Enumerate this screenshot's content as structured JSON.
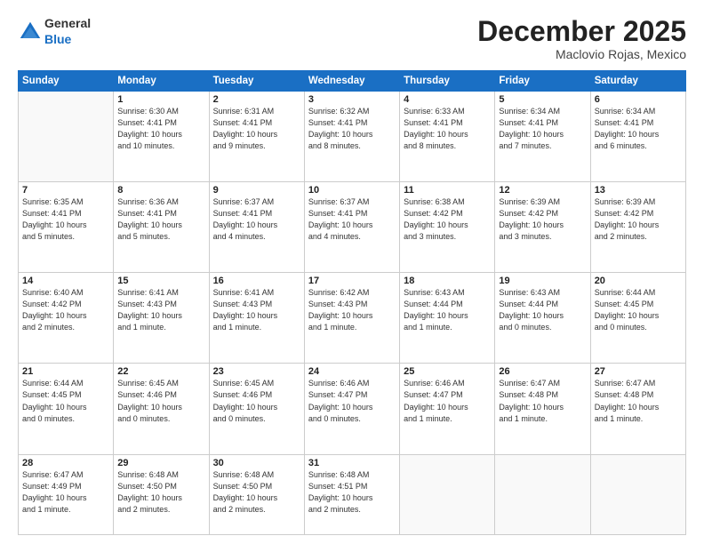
{
  "logo": {
    "general": "General",
    "blue": "Blue"
  },
  "title": "December 2025",
  "location": "Maclovio Rojas, Mexico",
  "days_header": [
    "Sunday",
    "Monday",
    "Tuesday",
    "Wednesday",
    "Thursday",
    "Friday",
    "Saturday"
  ],
  "weeks": [
    [
      {
        "day": "",
        "info": ""
      },
      {
        "day": "1",
        "info": "Sunrise: 6:30 AM\nSunset: 4:41 PM\nDaylight: 10 hours\nand 10 minutes."
      },
      {
        "day": "2",
        "info": "Sunrise: 6:31 AM\nSunset: 4:41 PM\nDaylight: 10 hours\nand 9 minutes."
      },
      {
        "day": "3",
        "info": "Sunrise: 6:32 AM\nSunset: 4:41 PM\nDaylight: 10 hours\nand 8 minutes."
      },
      {
        "day": "4",
        "info": "Sunrise: 6:33 AM\nSunset: 4:41 PM\nDaylight: 10 hours\nand 8 minutes."
      },
      {
        "day": "5",
        "info": "Sunrise: 6:34 AM\nSunset: 4:41 PM\nDaylight: 10 hours\nand 7 minutes."
      },
      {
        "day": "6",
        "info": "Sunrise: 6:34 AM\nSunset: 4:41 PM\nDaylight: 10 hours\nand 6 minutes."
      }
    ],
    [
      {
        "day": "7",
        "info": "Sunrise: 6:35 AM\nSunset: 4:41 PM\nDaylight: 10 hours\nand 5 minutes."
      },
      {
        "day": "8",
        "info": "Sunrise: 6:36 AM\nSunset: 4:41 PM\nDaylight: 10 hours\nand 5 minutes."
      },
      {
        "day": "9",
        "info": "Sunrise: 6:37 AM\nSunset: 4:41 PM\nDaylight: 10 hours\nand 4 minutes."
      },
      {
        "day": "10",
        "info": "Sunrise: 6:37 AM\nSunset: 4:41 PM\nDaylight: 10 hours\nand 4 minutes."
      },
      {
        "day": "11",
        "info": "Sunrise: 6:38 AM\nSunset: 4:42 PM\nDaylight: 10 hours\nand 3 minutes."
      },
      {
        "day": "12",
        "info": "Sunrise: 6:39 AM\nSunset: 4:42 PM\nDaylight: 10 hours\nand 3 minutes."
      },
      {
        "day": "13",
        "info": "Sunrise: 6:39 AM\nSunset: 4:42 PM\nDaylight: 10 hours\nand 2 minutes."
      }
    ],
    [
      {
        "day": "14",
        "info": "Sunrise: 6:40 AM\nSunset: 4:42 PM\nDaylight: 10 hours\nand 2 minutes."
      },
      {
        "day": "15",
        "info": "Sunrise: 6:41 AM\nSunset: 4:43 PM\nDaylight: 10 hours\nand 1 minute."
      },
      {
        "day": "16",
        "info": "Sunrise: 6:41 AM\nSunset: 4:43 PM\nDaylight: 10 hours\nand 1 minute."
      },
      {
        "day": "17",
        "info": "Sunrise: 6:42 AM\nSunset: 4:43 PM\nDaylight: 10 hours\nand 1 minute."
      },
      {
        "day": "18",
        "info": "Sunrise: 6:43 AM\nSunset: 4:44 PM\nDaylight: 10 hours\nand 1 minute."
      },
      {
        "day": "19",
        "info": "Sunrise: 6:43 AM\nSunset: 4:44 PM\nDaylight: 10 hours\nand 0 minutes."
      },
      {
        "day": "20",
        "info": "Sunrise: 6:44 AM\nSunset: 4:45 PM\nDaylight: 10 hours\nand 0 minutes."
      }
    ],
    [
      {
        "day": "21",
        "info": "Sunrise: 6:44 AM\nSunset: 4:45 PM\nDaylight: 10 hours\nand 0 minutes."
      },
      {
        "day": "22",
        "info": "Sunrise: 6:45 AM\nSunset: 4:46 PM\nDaylight: 10 hours\nand 0 minutes."
      },
      {
        "day": "23",
        "info": "Sunrise: 6:45 AM\nSunset: 4:46 PM\nDaylight: 10 hours\nand 0 minutes."
      },
      {
        "day": "24",
        "info": "Sunrise: 6:46 AM\nSunset: 4:47 PM\nDaylight: 10 hours\nand 0 minutes."
      },
      {
        "day": "25",
        "info": "Sunrise: 6:46 AM\nSunset: 4:47 PM\nDaylight: 10 hours\nand 1 minute."
      },
      {
        "day": "26",
        "info": "Sunrise: 6:47 AM\nSunset: 4:48 PM\nDaylight: 10 hours\nand 1 minute."
      },
      {
        "day": "27",
        "info": "Sunrise: 6:47 AM\nSunset: 4:48 PM\nDaylight: 10 hours\nand 1 minute."
      }
    ],
    [
      {
        "day": "28",
        "info": "Sunrise: 6:47 AM\nSunset: 4:49 PM\nDaylight: 10 hours\nand 1 minute."
      },
      {
        "day": "29",
        "info": "Sunrise: 6:48 AM\nSunset: 4:50 PM\nDaylight: 10 hours\nand 2 minutes."
      },
      {
        "day": "30",
        "info": "Sunrise: 6:48 AM\nSunset: 4:50 PM\nDaylight: 10 hours\nand 2 minutes."
      },
      {
        "day": "31",
        "info": "Sunrise: 6:48 AM\nSunset: 4:51 PM\nDaylight: 10 hours\nand 2 minutes."
      },
      {
        "day": "",
        "info": ""
      },
      {
        "day": "",
        "info": ""
      },
      {
        "day": "",
        "info": ""
      }
    ]
  ]
}
